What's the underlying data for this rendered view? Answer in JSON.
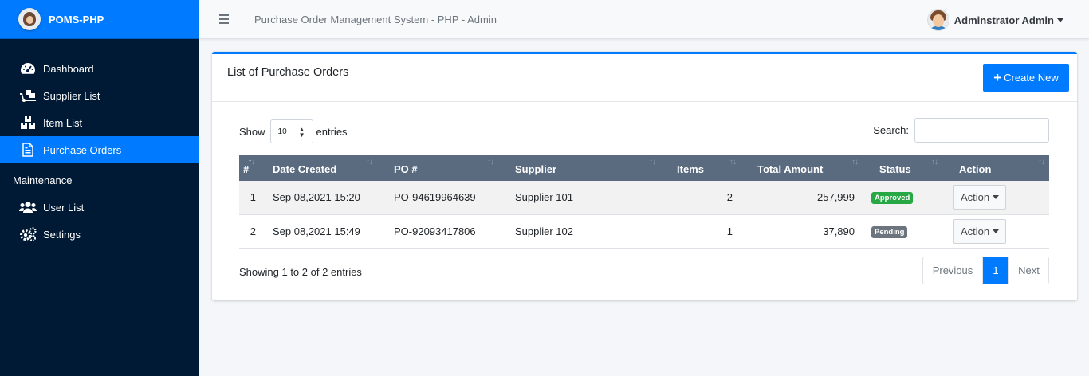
{
  "brand": {
    "name": "POMS-PHP"
  },
  "sidebar": {
    "items": [
      {
        "label": "Dashboard",
        "icon": "dashboard-icon"
      },
      {
        "label": "Supplier List",
        "icon": "truck-loading-icon"
      },
      {
        "label": "Item List",
        "icon": "boxes-icon"
      },
      {
        "label": "Purchase Orders",
        "icon": "file-invoice-icon",
        "active": true
      }
    ],
    "section_header": "Maintenance",
    "maintenance_items": [
      {
        "label": "User List",
        "icon": "users-icon"
      },
      {
        "label": "Settings",
        "icon": "cogs-icon"
      }
    ]
  },
  "topbar": {
    "title": "Purchase Order Management System - PHP - Admin",
    "user_name": "Adminstrator Admin"
  },
  "card": {
    "title": "List of Purchase Orders",
    "create_label": "Create New"
  },
  "table_controls": {
    "show_label": "Show",
    "page_length": "10",
    "entries_label": "entries",
    "search_label": "Search:"
  },
  "table": {
    "headers": [
      "#",
      "Date Created",
      "PO #",
      "Supplier",
      "Items",
      "Total Amount",
      "Status",
      "Action"
    ],
    "rows": [
      {
        "num": "1",
        "date": "Sep 08,2021 15:20",
        "po": "PO-94619964639",
        "supplier": "Supplier 101",
        "items": "2",
        "total": "257,999",
        "status": "Approved",
        "action": "Action"
      },
      {
        "num": "2",
        "date": "Sep 08,2021 15:49",
        "po": "PO-92093417806",
        "supplier": "Supplier 102",
        "items": "1",
        "total": "37,890",
        "status": "Pending",
        "action": "Action"
      }
    ]
  },
  "footer": {
    "info": "Showing 1 to 2 of 2 entries",
    "prev": "Previous",
    "current_page": "1",
    "next": "Next"
  },
  "colors": {
    "primary": "#007bff",
    "sidebar": "#001a35",
    "table_header": "#5a6b80",
    "approved": "#28a745",
    "pending": "#6c757d"
  }
}
